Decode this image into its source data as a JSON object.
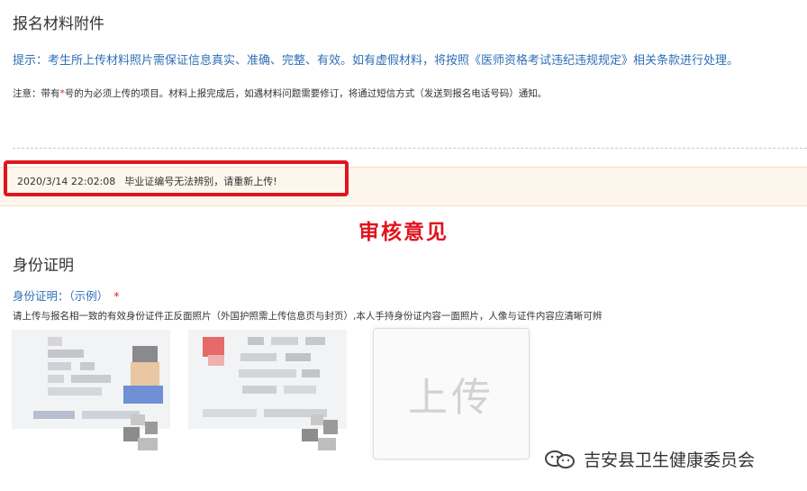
{
  "section": {
    "title": "报名材料附件"
  },
  "hint": "提示：考生所上传材料照片需保证信息真实、准确、完整、有效。如有虚假材料，将按照《医师资格考试违纪违规规定》相关条款进行处理。",
  "notice": {
    "before_star": "注意：带有",
    "star": "*",
    "after_star": "号的为必须上传的项目。材料上报完成后，如遇材料问题需要修订，将通过短信方式（发送到报名电话号码）通知。"
  },
  "review": {
    "timestamp": "2020/3/14 22:02:08",
    "message": "毕业证编号无法辨别，请重新上传!",
    "callout": "审核意见"
  },
  "identity": {
    "title": "身份证明",
    "label": "身份证明：（示例）",
    "required_mark": "*",
    "description": "请上传与报名相一致的有效身份证件正反面照片（外国护照需上传信息页与封页）,本人手持身份证内容一面照片，人像与证件内容应清晰可辨",
    "upload_label": "上传"
  },
  "watermark": {
    "text": "吉安县卫生健康委员会",
    "icon": "wechat-icon"
  },
  "colors": {
    "accent_blue": "#2f6fb5",
    "alert_red": "#e0141e",
    "review_bg": "#fdf6ec"
  }
}
